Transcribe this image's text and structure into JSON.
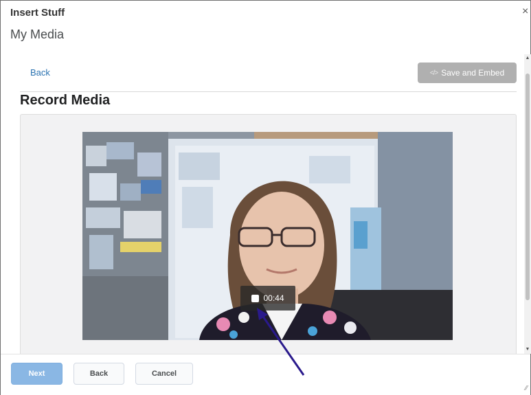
{
  "dialog": {
    "title": "Insert Stuff",
    "close_glyph": "×",
    "subtitle": "My Media"
  },
  "toolbar": {
    "back_label": "Back",
    "save_embed_label": "Save and Embed",
    "save_embed_icon": "code-icon"
  },
  "recorder": {
    "section_title": "Record Media",
    "timer": "00:44",
    "stop_icon": "stop-icon"
  },
  "footer": {
    "next_label": "Next",
    "back_label": "Back",
    "cancel_label": "Cancel"
  },
  "colors": {
    "link": "#2b73b1",
    "primary_button": "#8ab7e4",
    "disabled_button": "#b0b0b0",
    "annotation_arrow": "#2a1a8c"
  }
}
